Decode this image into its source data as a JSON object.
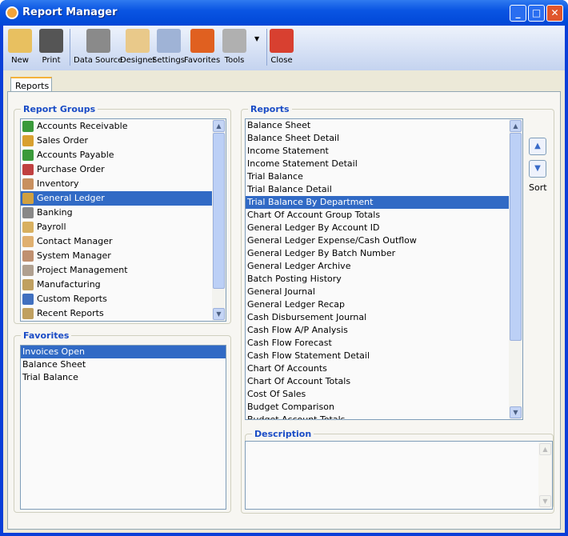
{
  "window": {
    "title": "Report Manager",
    "minimize": "_",
    "maximize": "□",
    "close": "✕"
  },
  "toolbar": [
    {
      "label": "New",
      "icon": "new-report-icon",
      "color": "#e8c060"
    },
    {
      "label": "Print",
      "icon": "printer-icon",
      "color": "#555"
    },
    {
      "label": "Data Source",
      "icon": "database-icon",
      "color": "#8a8a8a"
    },
    {
      "label": "Designer",
      "icon": "designer-icon",
      "color": "#e9c98a"
    },
    {
      "label": "Settings",
      "icon": "settings-icon",
      "color": "#9fb3d6"
    },
    {
      "label": "Favorites",
      "icon": "favorites-icon",
      "color": "#e06020"
    },
    {
      "label": "Tools",
      "icon": "tools-icon",
      "color": "#b0b0b0"
    },
    {
      "label": "Close",
      "icon": "close-report-icon",
      "color": "#d84030"
    }
  ],
  "tab": "Reports",
  "report_groups": {
    "title": "Report Groups",
    "selected": "General Ledger",
    "items": [
      {
        "label": "Accounts Receivable",
        "color": "#3a9a3a"
      },
      {
        "label": "Sales Order",
        "color": "#d8a030"
      },
      {
        "label": "Accounts Payable",
        "color": "#3a9a3a"
      },
      {
        "label": "Purchase Order",
        "color": "#c04040"
      },
      {
        "label": "Inventory",
        "color": "#c89060"
      },
      {
        "label": "General Ledger",
        "color": "#d0a040"
      },
      {
        "label": "Banking",
        "color": "#888888"
      },
      {
        "label": "Payroll",
        "color": "#d8b060"
      },
      {
        "label": "Contact Manager",
        "color": "#e0b070"
      },
      {
        "label": "System Manager",
        "color": "#c09070"
      },
      {
        "label": "Project Management",
        "color": "#b0a090"
      },
      {
        "label": "Manufacturing",
        "color": "#c0a060"
      },
      {
        "label": "Custom Reports",
        "color": "#4070c0"
      },
      {
        "label": "Recent Reports",
        "color": "#c0a060"
      }
    ]
  },
  "favorites": {
    "title": "Favorites",
    "selected": "Invoices Open",
    "items": [
      "Invoices Open",
      "Balance Sheet",
      "Trial Balance"
    ]
  },
  "reports": {
    "title": "Reports",
    "selected": "Trial Balance By Department",
    "items": [
      "Balance Sheet",
      "Balance Sheet Detail",
      "Income Statement",
      "Income Statement Detail",
      "Trial Balance",
      "Trial Balance Detail",
      "Trial Balance By Department",
      "Chart Of Account Group Totals",
      "General Ledger By Account ID",
      "General Ledger Expense/Cash Outflow",
      "General Ledger By Batch Number",
      "General Ledger Archive",
      "Batch Posting History",
      "General Journal",
      "General Ledger Recap",
      "Cash Disbursement Journal",
      "Cash Flow A/P Analysis",
      "Cash Flow Forecast",
      "Cash Flow Statement Detail",
      "Chart Of Accounts",
      "Chart Of Account Totals",
      "Cost Of Sales",
      "Budget Comparison",
      "Budget Account Totals"
    ]
  },
  "sort": {
    "label": "Sort",
    "up": "▲",
    "down": "▼"
  },
  "description": {
    "title": "Description",
    "text": ""
  }
}
